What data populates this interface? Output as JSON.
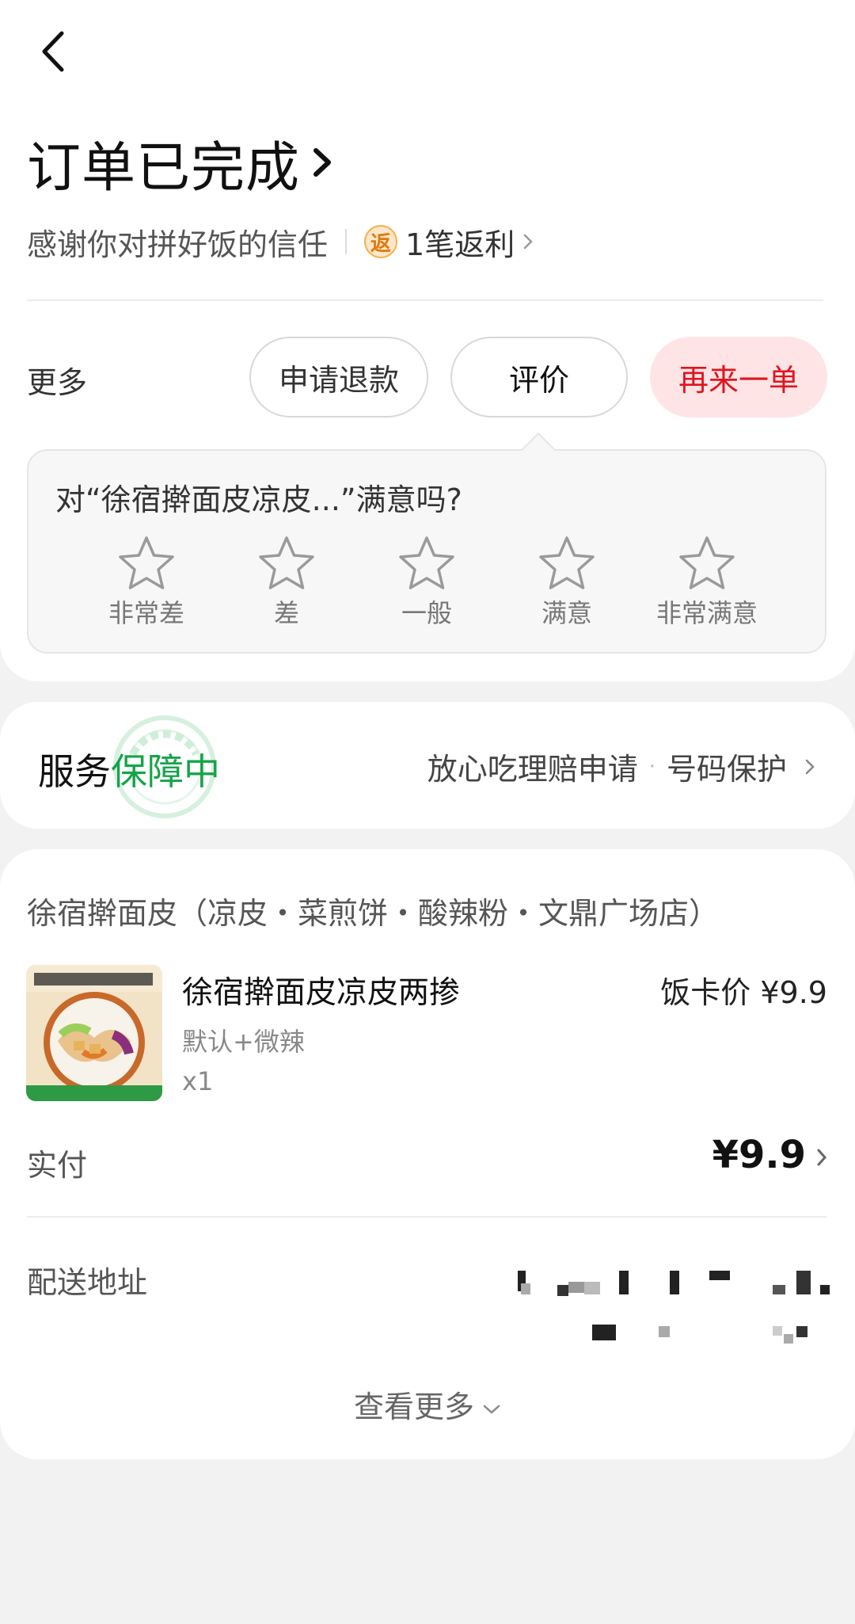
{
  "header": {
    "title": "订单已完成",
    "subtitle": "感谢你对拼好饭的信任",
    "rebate_badge": "返",
    "rebate_text": "1笔返利"
  },
  "actions": {
    "more_label": "更多",
    "refund_label": "申请退款",
    "review_label": "评价",
    "reorder_label": "再来一单"
  },
  "rating": {
    "question": "对“徐宿擀面皮凉皮...”满意吗?",
    "options": [
      "非常差",
      "差",
      "一般",
      "满意",
      "非常满意"
    ]
  },
  "service": {
    "title_prefix": "服务",
    "title_highlight": "保障中",
    "claim_link": "放心吃理赔申请",
    "dot": "·",
    "privacy_link": "号码保护"
  },
  "order": {
    "shop_name": "徐宿擀面皮（凉皮・菜煎饼・酸辣粉・文鼎广场店）",
    "item": {
      "name": "徐宿擀面皮凉皮两掺",
      "spec": "默认+微辣",
      "qty": "x1",
      "price": "饭卡价 ¥9.9"
    },
    "paid_label": "实付",
    "paid_amount": "¥9.9",
    "address_label": "配送地址",
    "see_more": "查看更多"
  },
  "colors": {
    "accent_red": "#e0141e",
    "reorder_bg": "#ffe4e6",
    "service_green": "#16a34a",
    "rebate_orange": "#e07a10"
  }
}
